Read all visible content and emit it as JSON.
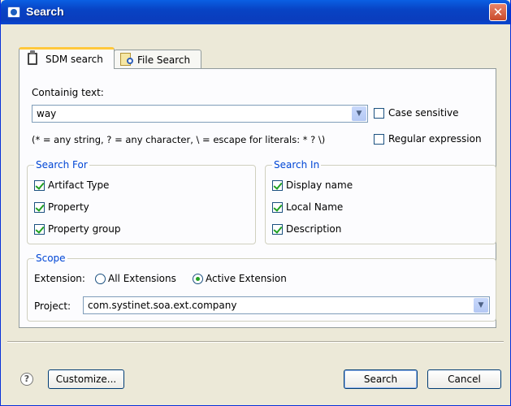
{
  "window": {
    "title": "Search",
    "close_label": "✕"
  },
  "tabs": [
    {
      "label": "SDM search",
      "icon": "clipboard-icon",
      "active": true
    },
    {
      "label": "File Search",
      "icon": "file-search-icon",
      "active": false
    }
  ],
  "containing": {
    "label": "Containig text:",
    "value": "way",
    "hint": "(* = any string, ? = any character, \\ = escape for literals: * ? \\)",
    "case_sensitive": {
      "label": "Case sensitive",
      "checked": false
    },
    "regex": {
      "label": "Regular expression",
      "checked": false
    }
  },
  "search_for": {
    "title": "Search For",
    "items": [
      {
        "label": "Artifact Type",
        "checked": true
      },
      {
        "label": "Property",
        "checked": true
      },
      {
        "label": "Property group",
        "checked": true
      }
    ]
  },
  "search_in": {
    "title": "Search In",
    "items": [
      {
        "label": "Display name",
        "checked": true
      },
      {
        "label": "Local Name",
        "checked": true
      },
      {
        "label": "Description",
        "checked": true
      }
    ]
  },
  "scope": {
    "title": "Scope",
    "extension_label": "Extension:",
    "options": [
      {
        "label": "All Extensions",
        "selected": false
      },
      {
        "label": "Active Extension",
        "selected": true
      }
    ],
    "project_label": "Project:",
    "project_value": "com.systinet.soa.ext.company"
  },
  "buttons": {
    "help": "?",
    "customize": "Customize...",
    "search": "Search",
    "cancel": "Cancel"
  },
  "colors": {
    "accent": "#0046d5",
    "titlebar": "#0a4fd6",
    "tab_highlight": "#ffc83c"
  }
}
